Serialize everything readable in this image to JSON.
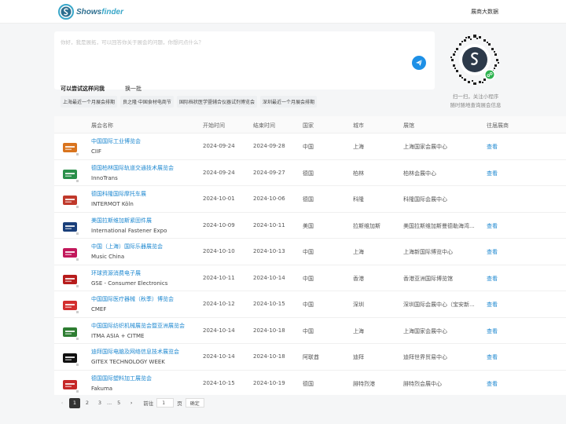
{
  "brand": {
    "name_part1": "Shows",
    "name_part2": "finder"
  },
  "nav": {
    "data_link": "展商大数据"
  },
  "ask": {
    "placeholder": "你好，我是展拓，可以回答你关于展会的问题，你想问点什么？",
    "try_title": "可以尝试这样问我",
    "refresh": "换一批",
    "suggestions": [
      "上海最近一个月展会排期",
      "良之隆·中国食材电商节",
      "国际档状医学暨辅合仪器试剂博览会",
      "深圳最近一个月展会排期"
    ]
  },
  "miniprogram": {
    "line1": "扫一扫，关注小程序",
    "line2": "随时随地查询展会信息"
  },
  "table": {
    "headers": [
      "展会名称",
      "开始时间",
      "结束时间",
      "国家",
      "城市",
      "展馆",
      "往届展商"
    ],
    "rows": [
      {
        "name_cn": "中国国际工业博览会",
        "name_en": "CIIF",
        "start": "2024-09-24",
        "end": "2024-09-28",
        "country": "中国",
        "city": "上海",
        "venue": "上海国家会展中心",
        "action": "查看",
        "logo_color": "#d9741e"
      },
      {
        "name_cn": "德国柏林国际轨道交通技术展览会",
        "name_en": "InnoTrans",
        "start": "2024-09-24",
        "end": "2024-09-27",
        "country": "德国",
        "city": "柏林",
        "venue": "柏林会展中心",
        "action": "查看",
        "logo_color": "#2a8f4a"
      },
      {
        "name_cn": "德国科隆国际摩托车展",
        "name_en": "INTERMOT Köln",
        "start": "2024-10-01",
        "end": "2024-10-06",
        "country": "德国",
        "city": "科隆",
        "venue": "科隆国际会展中心",
        "action": "",
        "logo_color": "#c0392b"
      },
      {
        "name_cn": "美国拉斯维加斯紧固件展",
        "name_en": "International Fastener Expo",
        "start": "2024-10-09",
        "end": "2024-10-11",
        "country": "美国",
        "city": "拉斯维加斯",
        "venue": "美国拉斯维加斯曼德勒海湾...",
        "action": "查看",
        "logo_color": "#1a3f7a"
      },
      {
        "name_cn": "中国（上海）国际乐器展览会",
        "name_en": "Music China",
        "start": "2024-10-10",
        "end": "2024-10-13",
        "country": "中国",
        "city": "上海",
        "venue": "上海新国际博览中心",
        "action": "查看",
        "logo_color": "#c2185b"
      },
      {
        "name_cn": "环球资源消费电子展",
        "name_en": "GSE - Consumer Electronics",
        "start": "2024-10-11",
        "end": "2024-10-14",
        "country": "中国",
        "city": "香港",
        "venue": "香港亚洲国际博览馆",
        "action": "查看",
        "logo_color": "#b71c1c"
      },
      {
        "name_cn": "中国国际医疗器械（秋季）博览会",
        "name_en": "CMEF",
        "start": "2024-10-12",
        "end": "2024-10-15",
        "country": "中国",
        "city": "深圳",
        "venue": "深圳国际会展中心（宝安新...",
        "action": "查看",
        "logo_color": "#d32f2f"
      },
      {
        "name_cn": "中国国际纺织机械展览会暨亚洲展览会",
        "name_en": "ITMA ASIA + CITME",
        "start": "2024-10-14",
        "end": "2024-10-18",
        "country": "中国",
        "city": "上海",
        "venue": "上海国家会展中心",
        "action": "查看",
        "logo_color": "#2e7d32"
      },
      {
        "name_cn": "迪拜国际电脑及网络信息技术展览会",
        "name_en": "GITEX TECHNOLOGY WEEK",
        "start": "2024-10-14",
        "end": "2024-10-18",
        "country": "阿联酋",
        "city": "迪拜",
        "venue": "迪拜世界贸易中心",
        "action": "查看",
        "logo_color": "#111111"
      },
      {
        "name_cn": "德国国际塑料加工展览会",
        "name_en": "Fakuma",
        "start": "2024-10-15",
        "end": "2024-10-19",
        "country": "德国",
        "city": "腓特烈港",
        "venue": "腓特烈会展中心",
        "action": "查看",
        "logo_color": "#c62828"
      }
    ]
  },
  "pagination": {
    "pages": [
      "1",
      "2",
      "3",
      "...",
      "5"
    ],
    "current": "1",
    "goto_label": "前往",
    "goto_value": "1",
    "page_suffix": "页",
    "confirm": "确定"
  }
}
